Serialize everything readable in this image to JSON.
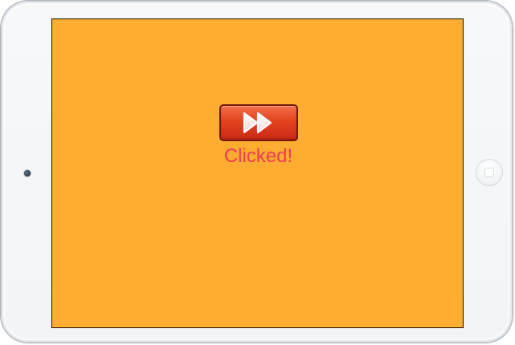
{
  "screen": {
    "background_color": "#ffac32",
    "status_text": "Clicked!",
    "status_color": "#f23b56"
  },
  "button": {
    "icon": "fast-forward-icon",
    "base_color": "#e3431f"
  },
  "device": {
    "frame_color": "#f4f6f8"
  }
}
